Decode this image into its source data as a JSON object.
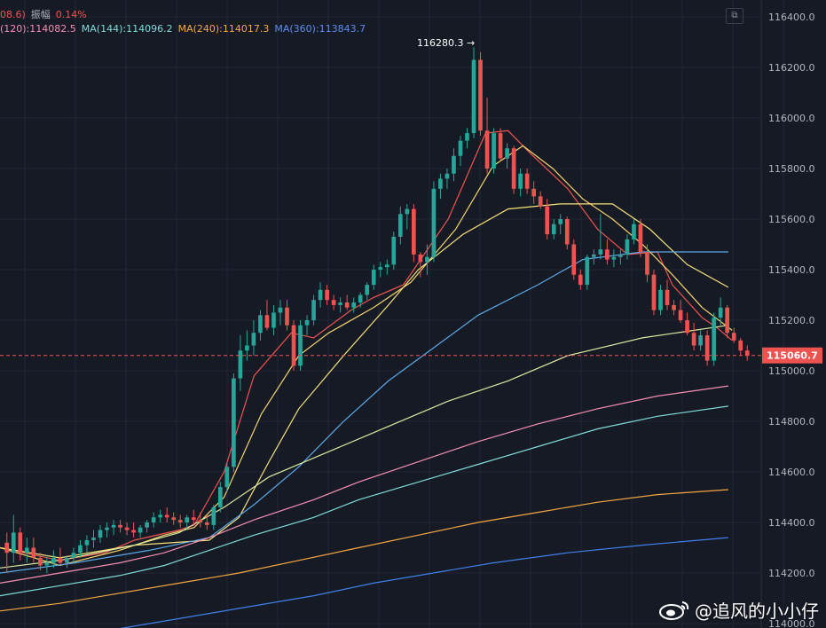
{
  "header": {
    "row1": [
      {
        "text": "08.6)",
        "color": "#ef5350"
      },
      {
        "text": "振幅",
        "color": "#b2b5be"
      },
      {
        "text": "0.14%",
        "color": "#ef5350"
      }
    ],
    "row2": [
      {
        "text": "(120):114082.5",
        "color": "#f48fb1"
      },
      {
        "text": "MA(144):114096.2",
        "color": "#7fdbda"
      },
      {
        "text": "MA(240):114017.3",
        "color": "#f5a742"
      },
      {
        "text": "MA(360):113843.7",
        "color": "#5b8def"
      }
    ]
  },
  "toggle_icon": "expand-icon",
  "watermark": {
    "text": "@追风的小小仔",
    "icon": "weibo-icon"
  },
  "chart_data": {
    "type": "candlestick",
    "ylim": [
      114000,
      116400
    ],
    "yticks": [
      "116400.0",
      "116200.0",
      "116000.0",
      "115800.0",
      "115600.0",
      "115400.0",
      "115200.0",
      "115000.0",
      "114800.0",
      "114600.0",
      "114400.0",
      "114200.0",
      "114000.0"
    ],
    "peak_label": "116280.3",
    "peak_value": 116280.3,
    "current_price": 115060.7,
    "current_price_label": "115060.7",
    "colors": {
      "up": "#26a69a",
      "down": "#ef5350",
      "grid": "#232734",
      "background": "#161a25"
    },
    "candles": [
      [
        114320,
        114360,
        114200,
        114280
      ],
      [
        114280,
        114430,
        114240,
        114360
      ],
      [
        114360,
        114380,
        114250,
        114280
      ],
      [
        114280,
        114340,
        114240,
        114300
      ],
      [
        114300,
        114340,
        114240,
        114260
      ],
      [
        114260,
        114280,
        114210,
        114230
      ],
      [
        114230,
        114270,
        114200,
        114240
      ],
      [
        114240,
        114290,
        114220,
        114260
      ],
      [
        114260,
        114300,
        114230,
        114240
      ],
      [
        114240,
        114270,
        114220,
        114260
      ],
      [
        114260,
        114300,
        114240,
        114280
      ],
      [
        114280,
        114330,
        114260,
        114310
      ],
      [
        114310,
        114350,
        114280,
        114330
      ],
      [
        114330,
        114370,
        114300,
        114340
      ],
      [
        114340,
        114390,
        114320,
        114370
      ],
      [
        114370,
        114400,
        114340,
        114380
      ],
      [
        114380,
        114410,
        114350,
        114390
      ],
      [
        114390,
        114410,
        114360,
        114380
      ],
      [
        114380,
        114400,
        114350,
        114370
      ],
      [
        114370,
        114400,
        114340,
        114360
      ],
      [
        114360,
        114390,
        114340,
        114380
      ],
      [
        114380,
        114410,
        114360,
        114400
      ],
      [
        114400,
        114440,
        114380,
        114420
      ],
      [
        114420,
        114450,
        114400,
        114430
      ],
      [
        114430,
        114460,
        114400,
        114420
      ],
      [
        114420,
        114440,
        114390,
        114410
      ],
      [
        114410,
        114430,
        114380,
        114400
      ],
      [
        114400,
        114430,
        114370,
        114420
      ],
      [
        114420,
        114450,
        114390,
        114410
      ],
      [
        114410,
        114440,
        114380,
        114400
      ],
      [
        114400,
        114430,
        114370,
        114390
      ],
      [
        114390,
        114470,
        114370,
        114460
      ],
      [
        114460,
        114560,
        114440,
        114540
      ],
      [
        114540,
        114640,
        114520,
        114620
      ],
      [
        114620,
        114990,
        114600,
        114970
      ],
      [
        114970,
        115140,
        114920,
        115080
      ],
      [
        115080,
        115160,
        115040,
        115100
      ],
      [
        115100,
        115200,
        115060,
        115150
      ],
      [
        115150,
        115240,
        115120,
        115220
      ],
      [
        115220,
        115280,
        115160,
        115170
      ],
      [
        115170,
        115260,
        115140,
        115230
      ],
      [
        115230,
        115280,
        115180,
        115250
      ],
      [
        115250,
        115280,
        115160,
        115180
      ],
      [
        115180,
        115200,
        115000,
        115020
      ],
      [
        115020,
        115200,
        115000,
        115180
      ],
      [
        115180,
        115220,
        115140,
        115200
      ],
      [
        115200,
        115300,
        115180,
        115280
      ],
      [
        115280,
        115350,
        115250,
        115320
      ],
      [
        115320,
        115340,
        115260,
        115280
      ],
      [
        115280,
        115300,
        115240,
        115260
      ],
      [
        115260,
        115290,
        115230,
        115270
      ],
      [
        115270,
        115300,
        115240,
        115250
      ],
      [
        115250,
        115290,
        115230,
        115270
      ],
      [
        115270,
        115310,
        115250,
        115300
      ],
      [
        115300,
        115350,
        115280,
        115340
      ],
      [
        115340,
        115420,
        115320,
        115400
      ],
      [
        115400,
        115430,
        115370,
        115410
      ],
      [
        115410,
        115440,
        115380,
        115420
      ],
      [
        115420,
        115550,
        115400,
        115530
      ],
      [
        115530,
        115650,
        115500,
        115620
      ],
      [
        115620,
        115660,
        115560,
        115640
      ],
      [
        115640,
        115660,
        115430,
        115460
      ],
      [
        115460,
        115470,
        115370,
        115430
      ],
      [
        115430,
        115500,
        115380,
        115450
      ],
      [
        115450,
        115750,
        115430,
        115720
      ],
      [
        115720,
        115780,
        115680,
        115760
      ],
      [
        115760,
        115800,
        115720,
        115780
      ],
      [
        115780,
        115880,
        115750,
        115850
      ],
      [
        115850,
        115930,
        115810,
        115910
      ],
      [
        115910,
        115960,
        115880,
        115940
      ],
      [
        115940,
        116280,
        115920,
        116230
      ],
      [
        116230,
        116260,
        115930,
        115950
      ],
      [
        115950,
        116080,
        115780,
        115800
      ],
      [
        115800,
        115960,
        115780,
        115940
      ],
      [
        115940,
        115960,
        115830,
        115840
      ],
      [
        115840,
        115900,
        115800,
        115880
      ],
      [
        115880,
        115890,
        115700,
        115720
      ],
      [
        115720,
        115800,
        115690,
        115780
      ],
      [
        115780,
        115800,
        115700,
        115720
      ],
      [
        115720,
        115750,
        115660,
        115690
      ],
      [
        115690,
        115710,
        115640,
        115650
      ],
      [
        115650,
        115680,
        115520,
        115540
      ],
      [
        115540,
        115600,
        115520,
        115580
      ],
      [
        115580,
        115620,
        115540,
        115600
      ],
      [
        115600,
        115610,
        115480,
        115500
      ],
      [
        115500,
        115520,
        115360,
        115380
      ],
      [
        115380,
        115400,
        115320,
        115340
      ],
      [
        115340,
        115460,
        115320,
        115450
      ],
      [
        115450,
        115480,
        115420,
        115460
      ],
      [
        115460,
        115620,
        115440,
        115480
      ],
      [
        115480,
        115520,
        115420,
        115440
      ],
      [
        115440,
        115480,
        115410,
        115450
      ],
      [
        115450,
        115480,
        115420,
        115460
      ],
      [
        115460,
        115540,
        115440,
        115520
      ],
      [
        115520,
        115600,
        115500,
        115580
      ],
      [
        115580,
        115600,
        115450,
        115470
      ],
      [
        115470,
        115500,
        115350,
        115380
      ],
      [
        115380,
        115400,
        115220,
        115240
      ],
      [
        115240,
        115340,
        115220,
        115320
      ],
      [
        115320,
        115360,
        115240,
        115260
      ],
      [
        115260,
        115280,
        115220,
        115240
      ],
      [
        115240,
        115280,
        115190,
        115200
      ],
      [
        115200,
        115230,
        115140,
        115150
      ],
      [
        115150,
        115190,
        115080,
        115100
      ],
      [
        115100,
        115160,
        115080,
        115140
      ],
      [
        115140,
        115160,
        115020,
        115040
      ],
      [
        115040,
        115230,
        115020,
        115210
      ],
      [
        115210,
        115290,
        115180,
        115250
      ],
      [
        115250,
        115260,
        115130,
        115150
      ],
      [
        115150,
        115170,
        115110,
        115120
      ],
      [
        115120,
        115130,
        115060,
        115080
      ],
      [
        115080,
        115100,
        115040,
        115060
      ]
    ],
    "ma_lines": [
      {
        "color": "#ef5350",
        "pts": [
          [
            114300,
            0
          ],
          [
            114250,
            0.08
          ],
          [
            114280,
            0.14
          ],
          [
            114330,
            0.18
          ],
          [
            114370,
            0.24
          ],
          [
            114390,
            0.26
          ],
          [
            114600,
            0.3
          ],
          [
            114980,
            0.34
          ],
          [
            115150,
            0.39
          ],
          [
            115130,
            0.42
          ],
          [
            115240,
            0.47
          ],
          [
            115290,
            0.5
          ],
          [
            115340,
            0.54
          ],
          [
            115600,
            0.6
          ],
          [
            115940,
            0.65
          ],
          [
            115950,
            0.68
          ],
          [
            115860,
            0.71
          ],
          [
            115720,
            0.76
          ],
          [
            115560,
            0.8
          ],
          [
            115460,
            0.84
          ],
          [
            115470,
            0.88
          ],
          [
            115340,
            0.9
          ],
          [
            115210,
            0.94
          ],
          [
            115170,
            0.96
          ],
          [
            115120,
            0.98
          ]
        ]
      },
      {
        "color": "#f5d36b",
        "pts": [
          [
            114300,
            0
          ],
          [
            114230,
            0.08
          ],
          [
            114290,
            0.16
          ],
          [
            114350,
            0.22
          ],
          [
            114380,
            0.26
          ],
          [
            114500,
            0.3
          ],
          [
            114830,
            0.35
          ],
          [
            115060,
            0.4
          ],
          [
            115150,
            0.44
          ],
          [
            115250,
            0.5
          ],
          [
            115350,
            0.55
          ],
          [
            115560,
            0.61
          ],
          [
            115810,
            0.66
          ],
          [
            115890,
            0.7
          ],
          [
            115800,
            0.74
          ],
          [
            115680,
            0.78
          ],
          [
            115600,
            0.82
          ],
          [
            115500,
            0.86
          ],
          [
            115380,
            0.9
          ],
          [
            115250,
            0.94
          ],
          [
            115160,
            0.98
          ]
        ]
      },
      {
        "color": "#f8e27a",
        "pts": [
          [
            114300,
            0
          ],
          [
            114260,
            0.08
          ],
          [
            114310,
            0.18
          ],
          [
            114330,
            0.28
          ],
          [
            114420,
            0.32
          ],
          [
            114640,
            0.36
          ],
          [
            114850,
            0.4
          ],
          [
            115060,
            0.46
          ],
          [
            115260,
            0.52
          ],
          [
            115400,
            0.56
          ],
          [
            115540,
            0.62
          ],
          [
            115640,
            0.68
          ],
          [
            115660,
            0.75
          ],
          [
            115660,
            0.82
          ],
          [
            115560,
            0.87
          ],
          [
            115420,
            0.92
          ],
          [
            115330,
            0.975
          ]
        ]
      },
      {
        "color": "#5aa9e6",
        "pts": [
          [
            114200,
            0
          ],
          [
            114240,
            0.1
          ],
          [
            114290,
            0.2
          ],
          [
            114340,
            0.28
          ],
          [
            114470,
            0.34
          ],
          [
            114620,
            0.4
          ],
          [
            114800,
            0.46
          ],
          [
            114960,
            0.52
          ],
          [
            115090,
            0.58
          ],
          [
            115220,
            0.64
          ],
          [
            115340,
            0.72
          ],
          [
            115440,
            0.78
          ],
          [
            115470,
            0.86
          ],
          [
            115470,
            0.975
          ]
        ]
      },
      {
        "color": "#dde8a0",
        "pts": [
          [
            114220,
            0
          ],
          [
            114250,
            0.08
          ],
          [
            114310,
            0.18
          ],
          [
            114360,
            0.24
          ],
          [
            114460,
            0.3
          ],
          [
            114580,
            0.36
          ],
          [
            114680,
            0.44
          ],
          [
            114780,
            0.52
          ],
          [
            114880,
            0.6
          ],
          [
            114960,
            0.68
          ],
          [
            115060,
            0.76
          ],
          [
            115130,
            0.86
          ],
          [
            115180,
            0.975
          ]
        ]
      },
      {
        "color": "#f48fb1",
        "pts": [
          [
            114160,
            0
          ],
          [
            114200,
            0.08
          ],
          [
            114240,
            0.16
          ],
          [
            114280,
            0.22
          ],
          [
            114340,
            0.28
          ],
          [
            114410,
            0.34
          ],
          [
            114490,
            0.42
          ],
          [
            114560,
            0.48
          ],
          [
            114640,
            0.56
          ],
          [
            114720,
            0.64
          ],
          [
            114790,
            0.72
          ],
          [
            114850,
            0.8
          ],
          [
            114900,
            0.88
          ],
          [
            114940,
            0.975
          ]
        ]
      },
      {
        "color": "#7fdbda",
        "pts": [
          [
            114110,
            0
          ],
          [
            114150,
            0.08
          ],
          [
            114190,
            0.16
          ],
          [
            114230,
            0.22
          ],
          [
            114290,
            0.28
          ],
          [
            114350,
            0.34
          ],
          [
            114420,
            0.42
          ],
          [
            114490,
            0.48
          ],
          [
            114560,
            0.56
          ],
          [
            114630,
            0.64
          ],
          [
            114700,
            0.72
          ],
          [
            114770,
            0.8
          ],
          [
            114820,
            0.88
          ],
          [
            114860,
            0.975
          ]
        ]
      },
      {
        "color": "#f5a742",
        "pts": [
          [
            114050,
            0
          ],
          [
            114080,
            0.08
          ],
          [
            114120,
            0.16
          ],
          [
            114160,
            0.24
          ],
          [
            114200,
            0.32
          ],
          [
            114250,
            0.4
          ],
          [
            114300,
            0.48
          ],
          [
            114350,
            0.56
          ],
          [
            114400,
            0.64
          ],
          [
            114440,
            0.72
          ],
          [
            114480,
            0.8
          ],
          [
            114510,
            0.88
          ],
          [
            114530,
            0.975
          ]
        ]
      },
      {
        "color": "#3f7fe8",
        "pts": [
          [
            113920,
            0
          ],
          [
            113960,
            0.12
          ],
          [
            114000,
            0.2
          ],
          [
            114030,
            0.26
          ],
          [
            114070,
            0.34
          ],
          [
            114110,
            0.42
          ],
          [
            114160,
            0.5
          ],
          [
            114200,
            0.58
          ],
          [
            114240,
            0.66
          ],
          [
            114280,
            0.76
          ],
          [
            114310,
            0.86
          ],
          [
            114340,
            0.975
          ]
        ]
      }
    ]
  }
}
